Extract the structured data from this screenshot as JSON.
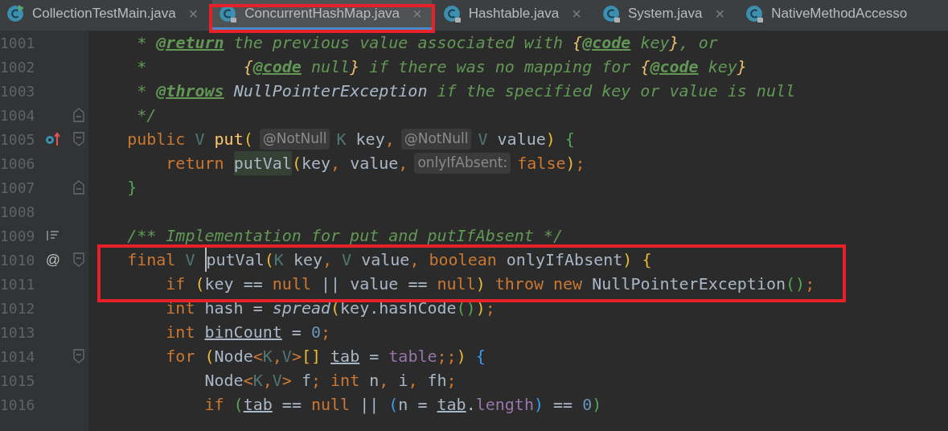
{
  "tabs": [
    {
      "label": "CollectionTestMain.java",
      "selected": false,
      "kind": "runnable",
      "outlined": false,
      "close": "×"
    },
    {
      "label": "ConcurrentHashMap.java",
      "selected": true,
      "kind": "locked",
      "outlined": true,
      "close": "×"
    },
    {
      "label": "Hashtable.java",
      "selected": false,
      "kind": "locked",
      "outlined": false,
      "close": "×"
    },
    {
      "label": "System.java",
      "selected": false,
      "kind": "locked",
      "outlined": false,
      "close": "×"
    },
    {
      "label": "NativeMethodAccesso",
      "selected": false,
      "kind": "locked",
      "outlined": false
    }
  ],
  "editor": {
    "lines": [
      {
        "number": "1001",
        "tokens": [
          {
            "t": "     * ",
            "kind": "doc"
          },
          {
            "t": "@return",
            "kind": "doctag"
          },
          {
            "t": " the previous value associated with ",
            "kind": "doc"
          },
          {
            "t": "{",
            "kind": "docbrace"
          },
          {
            "t": "@code",
            "kind": "doctag"
          },
          {
            "t": " key",
            "kind": "doc"
          },
          {
            "t": "}",
            "kind": "docbrace"
          },
          {
            "t": ", or",
            "kind": "doc"
          }
        ]
      },
      {
        "number": "1002",
        "tokens": [
          {
            "t": "     *          ",
            "kind": "doc"
          },
          {
            "t": "{",
            "kind": "docbrace"
          },
          {
            "t": "@code",
            "kind": "doctag"
          },
          {
            "t": " null",
            "kind": "doc"
          },
          {
            "t": "}",
            "kind": "docbrace"
          },
          {
            "t": " if there was no mapping for ",
            "kind": "doc"
          },
          {
            "t": "{",
            "kind": "docbrace"
          },
          {
            "t": "@code",
            "kind": "doctag"
          },
          {
            "t": " key",
            "kind": "doc"
          },
          {
            "t": "}",
            "kind": "docbrace"
          }
        ]
      },
      {
        "number": "1003",
        "tokens": [
          {
            "t": "     * ",
            "kind": "doc"
          },
          {
            "t": "@throws",
            "kind": "doctag"
          },
          {
            "t": " NullPointerException",
            "kind": "docref"
          },
          {
            "t": " if the specified key or value is null",
            "kind": "doc"
          }
        ]
      },
      {
        "number": "1004",
        "fold_mark": {
          "kind": "end"
        },
        "tokens": [
          {
            "t": "     */",
            "kind": "doc"
          }
        ]
      },
      {
        "number": "1005",
        "fold_mark": {
          "kind": "start"
        },
        "gutter_mark": {
          "kind": "override"
        },
        "tokens": [
          {
            "t": "    public",
            "kind": "kw"
          },
          {
            "t": " V",
            "kind": "tparam"
          },
          {
            "t": " put",
            "kind": "method"
          },
          {
            "t": "(",
            "kind": "b1"
          },
          {
            "t": "@NotNull",
            "kind": "hint"
          },
          {
            "t": "K",
            "kind": "tparam"
          },
          {
            "t": " key",
            "kind": "plain"
          },
          {
            "t": ",",
            "kind": "kw"
          },
          {
            "t": "@NotNull",
            "kind": "hint"
          },
          {
            "t": "V",
            "kind": "tparam"
          },
          {
            "t": " value",
            "kind": "plain"
          },
          {
            "t": ")",
            "kind": "b1"
          },
          {
            "t": " {",
            "kind": "b2"
          }
        ]
      },
      {
        "number": "1006",
        "tokens": [
          {
            "t": "        return ",
            "kind": "kw"
          },
          {
            "t": "putVal",
            "kind": "usage"
          },
          {
            "t": "(",
            "kind": "b1"
          },
          {
            "t": "key",
            "kind": "plain"
          },
          {
            "t": ",",
            "kind": "kw"
          },
          {
            "t": " value",
            "kind": "plain"
          },
          {
            "t": ",",
            "kind": "kw"
          },
          {
            "t": "onlyIfAbsent:",
            "kind": "hint"
          },
          {
            "t": "false",
            "kind": "kw"
          },
          {
            "t": ")",
            "kind": "b1"
          },
          {
            "t": ";",
            "kind": "kw"
          }
        ]
      },
      {
        "number": "1007",
        "fold_mark": {
          "kind": "end"
        },
        "tokens": [
          {
            "t": "    }",
            "kind": "b2"
          }
        ]
      },
      {
        "number": "1008"
      },
      {
        "number": "1009",
        "gutter_mark": {
          "kind": "doc"
        },
        "tokens": [
          {
            "t": "    /** Implementation for put and putIfAbsent */",
            "kind": "doc"
          }
        ]
      },
      {
        "number": "1010",
        "fold_mark": {
          "kind": "start"
        },
        "gutter_text": "@",
        "outlined": true,
        "tokens": [
          {
            "t": "    final",
            "kind": "kw"
          },
          {
            "t": " V ",
            "kind": "tparam"
          },
          {
            "t": "putVal",
            "kind": "caret"
          },
          {
            "t": "(",
            "kind": "b1"
          },
          {
            "t": "K",
            "kind": "tparam"
          },
          {
            "t": " key",
            "kind": "plain"
          },
          {
            "t": ",",
            "kind": "kw"
          },
          {
            "t": " V",
            "kind": "tparam"
          },
          {
            "t": " value",
            "kind": "plain"
          },
          {
            "t": ",",
            "kind": "kw"
          },
          {
            "t": " boolean",
            "kind": "kw"
          },
          {
            "t": " onlyIfAbsent",
            "kind": "plain"
          },
          {
            "t": ")",
            "kind": "b1"
          },
          {
            "t": " {",
            "kind": "b1"
          }
        ]
      },
      {
        "number": "1011",
        "outlined": true,
        "tokens": [
          {
            "t": "        if",
            "kind": "kw"
          },
          {
            "t": " (",
            "kind": "b1"
          },
          {
            "t": "key == ",
            "kind": "plain"
          },
          {
            "t": "null",
            "kind": "kw"
          },
          {
            "t": " || value == ",
            "kind": "plain"
          },
          {
            "t": "null",
            "kind": "kw"
          },
          {
            "t": ")",
            "kind": "b1"
          },
          {
            "t": " throw new",
            "kind": "kw"
          },
          {
            "t": " NullPointerException",
            "kind": "plain"
          },
          {
            "t": "()",
            "kind": "b2"
          },
          {
            "t": ";",
            "kind": "kw"
          }
        ]
      },
      {
        "number": "1012",
        "tokens": [
          {
            "t": "        int",
            "kind": "kw"
          },
          {
            "t": " hash = ",
            "kind": "plain"
          },
          {
            "t": "spread",
            "kind": "static"
          },
          {
            "t": "(",
            "kind": "b1"
          },
          {
            "t": "key.hashCode",
            "kind": "plain"
          },
          {
            "t": "()",
            "kind": "b2"
          },
          {
            "t": ")",
            "kind": "b1"
          },
          {
            "t": ";",
            "kind": "kw"
          }
        ]
      },
      {
        "number": "1013",
        "tokens": [
          {
            "t": "        int ",
            "kind": "kw"
          },
          {
            "t": "binCount",
            "kind": "reassigned"
          },
          {
            "t": " = ",
            "kind": "plain"
          },
          {
            "t": "0",
            "kind": "number"
          },
          {
            "t": ";",
            "kind": "kw"
          }
        ]
      },
      {
        "number": "1014",
        "fold_mark": {
          "kind": "start"
        },
        "tokens": [
          {
            "t": "        for",
            "kind": "kw"
          },
          {
            "t": " (",
            "kind": "b1"
          },
          {
            "t": "Node",
            "kind": "plain"
          },
          {
            "t": "<",
            "kind": "kw"
          },
          {
            "t": "K",
            "kind": "tparam"
          },
          {
            "t": ",",
            "kind": "kw"
          },
          {
            "t": "V",
            "kind": "tparam"
          },
          {
            "t": ">",
            "kind": "kw"
          },
          {
            "t": "[] ",
            "kind": "b1"
          },
          {
            "t": "tab",
            "kind": "reassigned"
          },
          {
            "t": " = ",
            "kind": "plain"
          },
          {
            "t": "table",
            "kind": "field"
          },
          {
            "t": ";;",
            "kind": "kw"
          },
          {
            "t": ")",
            "kind": "b1"
          },
          {
            "t": " {",
            "kind": "b3"
          }
        ]
      },
      {
        "number": "1015",
        "tokens": [
          {
            "t": "            Node",
            "kind": "plain"
          },
          {
            "t": "<",
            "kind": "kw"
          },
          {
            "t": "K",
            "kind": "tparam"
          },
          {
            "t": ",",
            "kind": "kw"
          },
          {
            "t": "V",
            "kind": "tparam"
          },
          {
            "t": ">",
            "kind": "kw"
          },
          {
            "t": " f",
            "kind": "plain"
          },
          {
            "t": ";",
            "kind": "kw"
          },
          {
            "t": " int",
            "kind": "kw"
          },
          {
            "t": " n",
            "kind": "plain"
          },
          {
            "t": ",",
            "kind": "kw"
          },
          {
            "t": " i",
            "kind": "plain"
          },
          {
            "t": ",",
            "kind": "kw"
          },
          {
            "t": " fh",
            "kind": "plain"
          },
          {
            "t": ";",
            "kind": "kw"
          }
        ]
      },
      {
        "number": "1016",
        "tokens": [
          {
            "t": "            if",
            "kind": "kw"
          },
          {
            "t": " (",
            "kind": "b2"
          },
          {
            "t": "tab",
            "kind": "reassigned"
          },
          {
            "t": " == ",
            "kind": "plain"
          },
          {
            "t": "null",
            "kind": "kw"
          },
          {
            "t": " || ",
            "kind": "plain"
          },
          {
            "t": "(",
            "kind": "b3"
          },
          {
            "t": "n = ",
            "kind": "plain"
          },
          {
            "t": "tab",
            "kind": "reassigned"
          },
          {
            "t": ".",
            "kind": "plain"
          },
          {
            "t": "length",
            "kind": "field"
          },
          {
            "t": ")",
            "kind": "b3"
          },
          {
            "t": " == ",
            "kind": "plain"
          },
          {
            "t": "0",
            "kind": "number"
          },
          {
            "t": ")",
            "kind": "b2"
          }
        ]
      }
    ]
  }
}
